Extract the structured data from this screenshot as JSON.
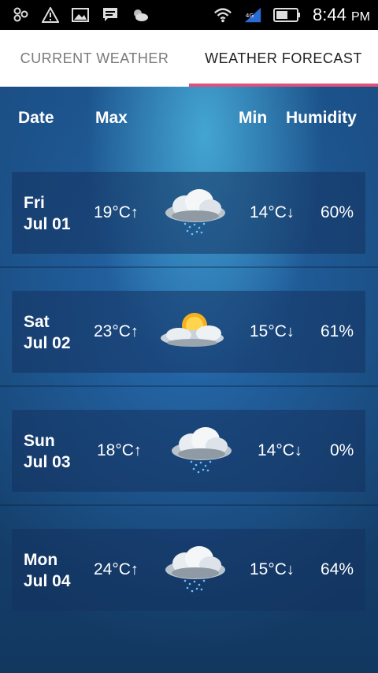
{
  "status_bar": {
    "time": "8:44",
    "ampm": "PM",
    "icons": [
      "notification-icon",
      "warning-icon",
      "image-icon",
      "message-icon",
      "weather-icon",
      "wifi-icon",
      "signal-icon",
      "battery-icon"
    ]
  },
  "tabs": [
    {
      "label": "CURRENT WEATHER",
      "active": false
    },
    {
      "label": "WEATHER FORECAST",
      "active": true
    }
  ],
  "columns": {
    "date": "Date",
    "max": "Max",
    "min": "Min",
    "humidity": "Humidity"
  },
  "forecast": [
    {
      "day": "Fri",
      "date": "Jul 01",
      "max": "19°C",
      "min": "14°C",
      "humidity": "60%",
      "icon": "rain-cloud-icon"
    },
    {
      "day": "Sat",
      "date": "Jul 02",
      "max": "23°C",
      "min": "15°C",
      "humidity": "61%",
      "icon": "partly-cloudy-icon"
    },
    {
      "day": "Sun",
      "date": "Jul 03",
      "max": "18°C",
      "min": "14°C",
      "humidity": "0%",
      "icon": "rain-cloud-icon"
    },
    {
      "day": "Mon",
      "date": "Jul 04",
      "max": "24°C",
      "min": "15°C",
      "humidity": "64%",
      "icon": "rain-cloud-icon"
    }
  ],
  "arrows": {
    "up": "↑",
    "down": "↓"
  },
  "colors": {
    "tab_indicator": "#e0507a",
    "background": "#174676"
  }
}
